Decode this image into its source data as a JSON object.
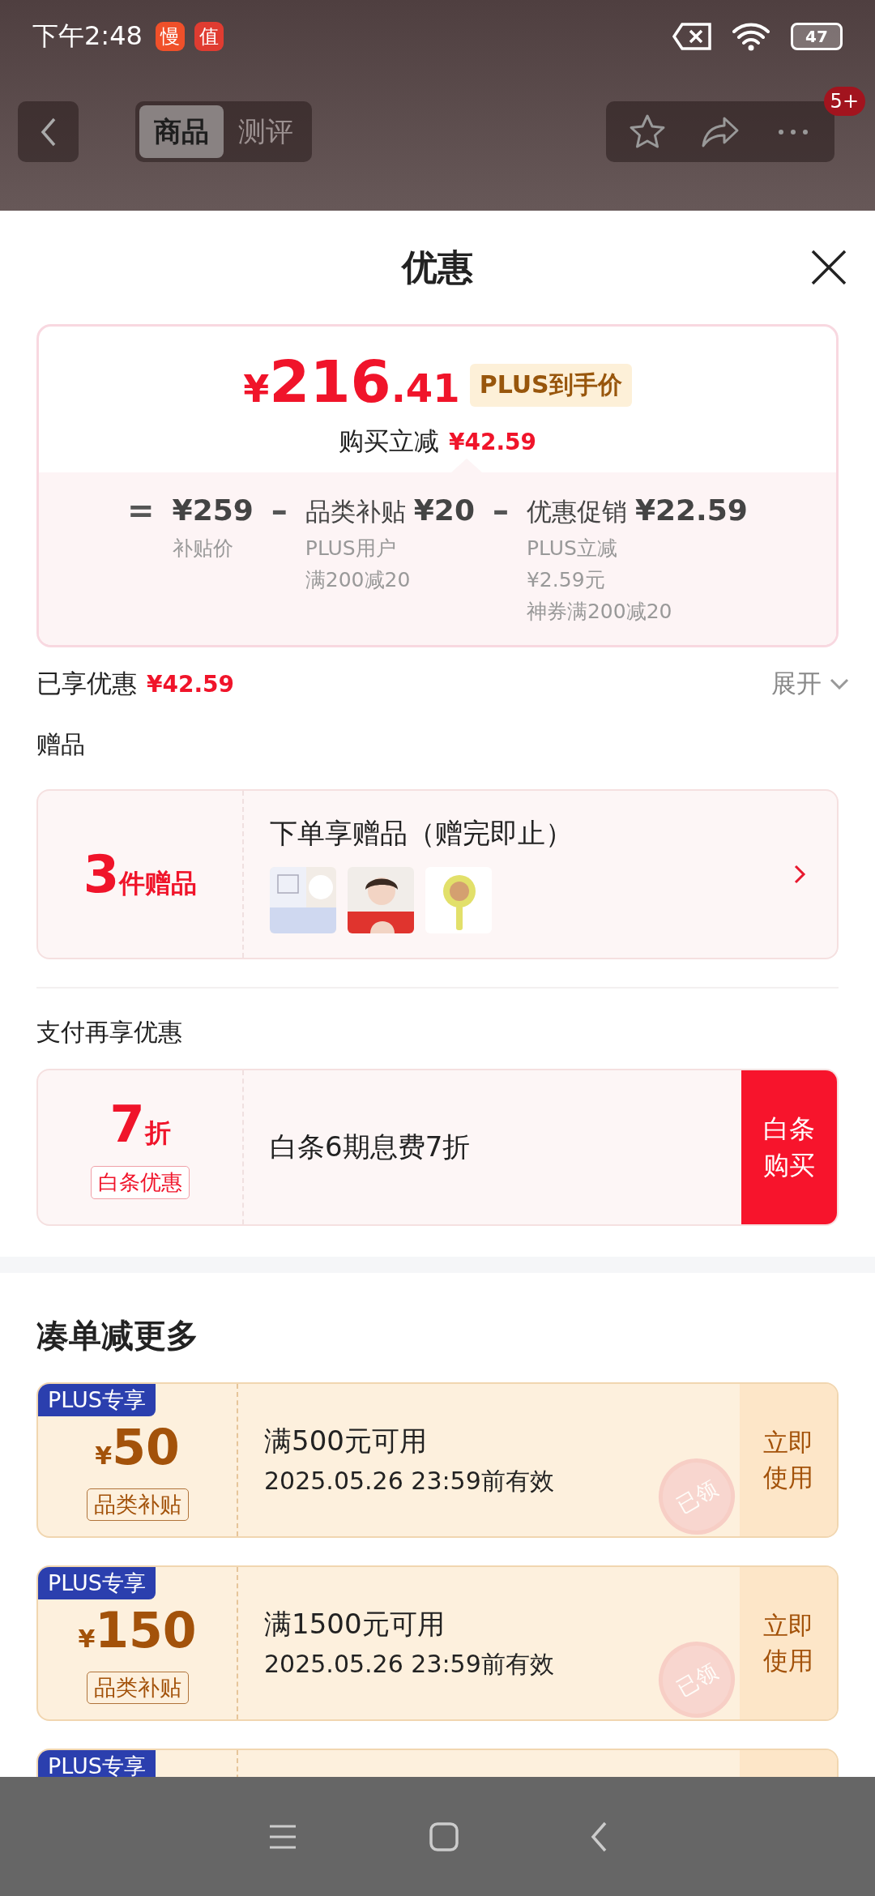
{
  "status_bar": {
    "time": "下午2:48",
    "app_icons": [
      {
        "label": "慢",
        "color": "#f0502a"
      },
      {
        "label": "值",
        "color": "#e03c31"
      }
    ],
    "battery": "47"
  },
  "nav": {
    "tabs": [
      {
        "label": "商品",
        "selected": true
      },
      {
        "label": "测评",
        "selected": false
      }
    ],
    "badge": "5+"
  },
  "sheet": {
    "title": "优惠"
  },
  "price_summary": {
    "currency": "¥",
    "price_int": "216",
    "price_dec": ".41",
    "price_tag": "PLUS到手价",
    "savings_label": "购买立减",
    "savings": "¥42.59",
    "breakdown": [
      {
        "op": "=",
        "amount": "¥259",
        "details": [
          "补贴价"
        ]
      },
      {
        "op": "–",
        "title": "品类补贴",
        "amount": "¥20",
        "details": [
          "PLUS用户",
          "满200减20"
        ]
      },
      {
        "op": "–",
        "title": "优惠促销",
        "amount": "¥22.59",
        "details": [
          "PLUS立减",
          "¥2.59元",
          "神券满200减20"
        ]
      }
    ]
  },
  "enjoyed": {
    "label": "已享优惠",
    "amount": "¥42.59",
    "toggle": "展开",
    "expanded": false
  },
  "gifts": {
    "heading": "赠品",
    "count": "3",
    "count_unit": "件赠品",
    "title": "下单享赠品（赠完即止）"
  },
  "payment": {
    "heading": "支付再享优惠",
    "discount": "7",
    "discount_unit": "折",
    "tag": "白条优惠",
    "text": "白条6期息费7折",
    "button": "白条购买"
  },
  "coupons": {
    "heading": "凑单减更多",
    "items": [
      {
        "badge": "PLUS专享",
        "currency": "¥",
        "amount": "50",
        "type": "品类补贴",
        "condition": "满500元可用",
        "validity": "2025.05.26 23:59前有效",
        "action": "立即使用",
        "stamp": "已领"
      },
      {
        "badge": "PLUS专享",
        "currency": "¥",
        "amount": "150",
        "type": "品类补贴",
        "condition": "满1500元可用",
        "validity": "2025.05.26 23:59前有效",
        "action": "立即使用",
        "stamp": "已领"
      },
      {
        "badge": "PLUS专享"
      }
    ]
  }
}
